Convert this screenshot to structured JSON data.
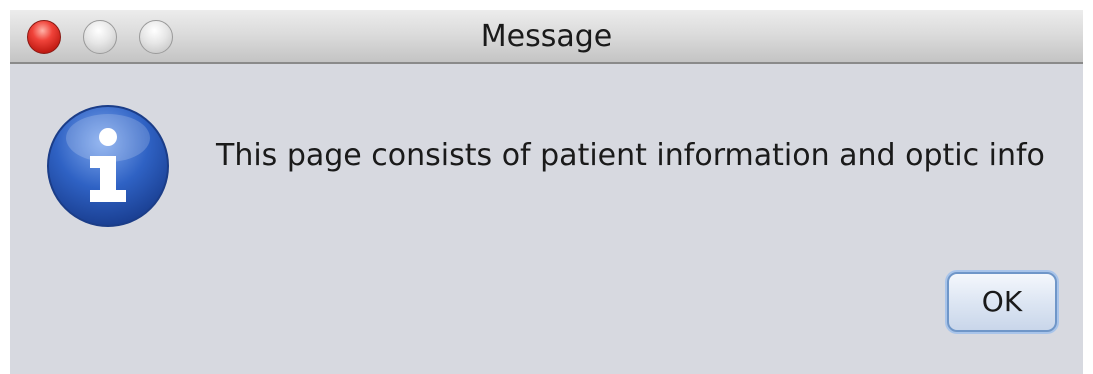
{
  "window": {
    "title": "Message"
  },
  "dialog": {
    "icon": "info-icon",
    "message": "This page consists of patient information and optic info",
    "ok_label": "OK"
  },
  "colors": {
    "background": "#d7d9e0",
    "close_button": "#e2372e",
    "info_icon": "#2f62c4",
    "ok_focus_ring": "#6f96c8"
  }
}
